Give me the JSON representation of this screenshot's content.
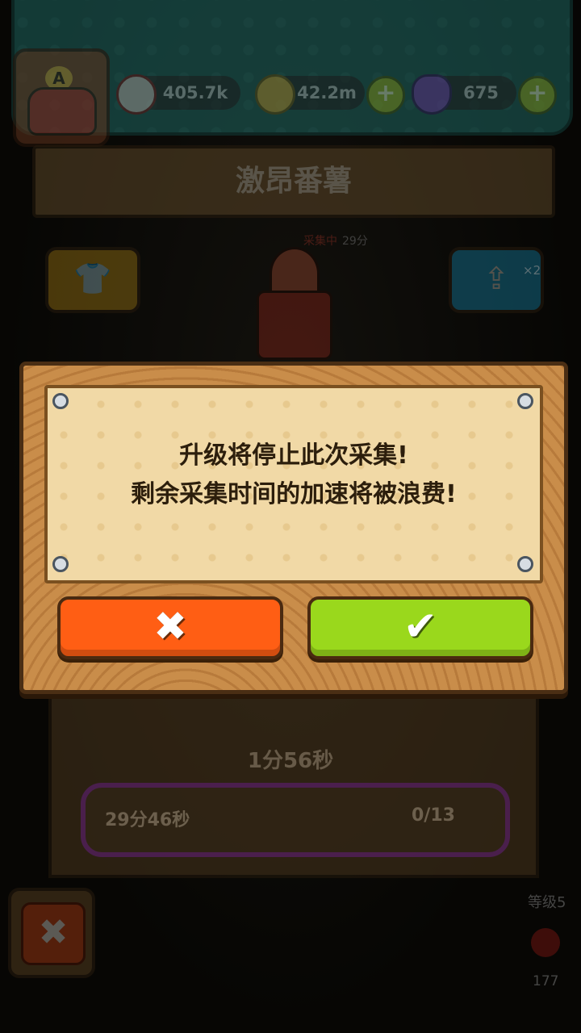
{
  "header": {
    "avatar_letter": "A",
    "resources": [
      {
        "name": "eyeball",
        "icon": "eyeball-icon",
        "value": "405.7k"
      },
      {
        "name": "coin",
        "icon": "coin-icon",
        "value": "42.2m"
      },
      {
        "name": "potion",
        "icon": "potion-icon",
        "value": "675"
      }
    ],
    "title": "激昂番薯"
  },
  "background": {
    "collect_label": "采集中",
    "collect_time": "29分",
    "share_multiplier": "×2",
    "timer": "1分56秒",
    "progress_time": "29分46秒",
    "progress_count": "0/13",
    "level_label": "等级5",
    "apple_count": "177"
  },
  "dialog": {
    "message_line1": "升级将停止此次采集!",
    "message_line2": "剩余采集时间的加速将被浪费!",
    "cancel_icon": "x-icon",
    "confirm_icon": "check-icon"
  },
  "colors": {
    "dialog_wood": "#c78a48",
    "parchment": "#f1d9a6",
    "cancel": "#ff5e14",
    "confirm": "#9ad81c",
    "progress_border": "#9a2fc2"
  }
}
